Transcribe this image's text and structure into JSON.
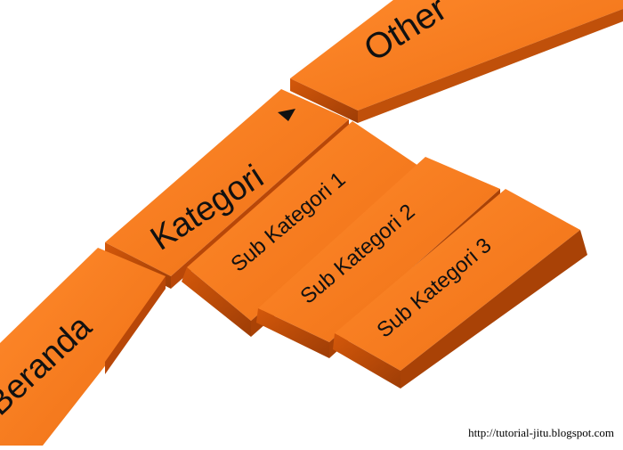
{
  "menu": {
    "items": [
      {
        "label": "Beranda"
      },
      {
        "label": "Kategori",
        "has_dropdown": true,
        "dropdown_icon": "triangle-down-icon"
      },
      {
        "label": "Other"
      }
    ],
    "submenu": [
      {
        "label": "Sub Kategori 1"
      },
      {
        "label": "Sub Kategori 2"
      },
      {
        "label": "Sub Kategori 3"
      }
    ]
  },
  "watermark": "http://tutorial-jitu.blogspot.com",
  "colors": {
    "top_face": "#f87a1c",
    "side_face": "#b84708",
    "front_face": "#d8600c",
    "edge": "#7a2e04",
    "text": "#111111"
  }
}
